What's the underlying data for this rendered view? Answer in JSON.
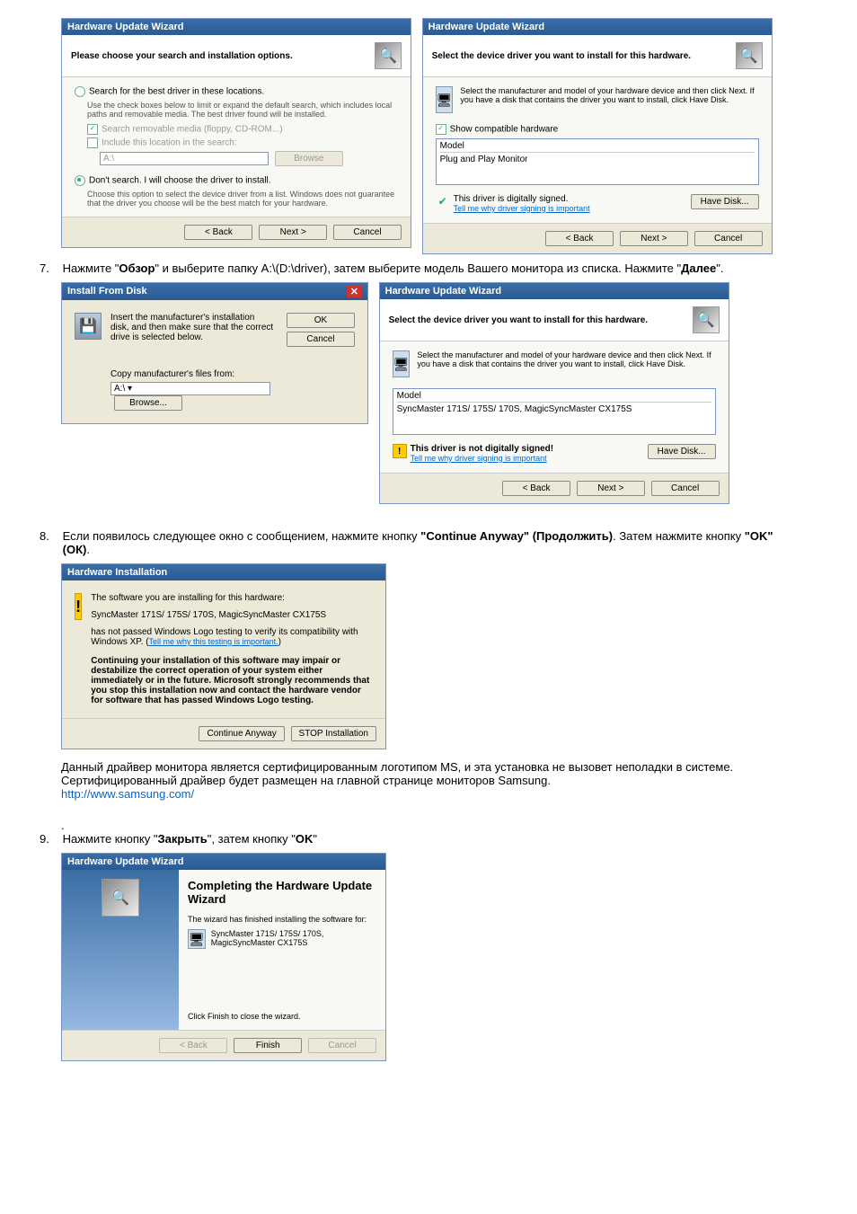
{
  "step7": {
    "num": "7.",
    "text_a": "Нажмите \"",
    "bold_a": "Обзор",
    "text_b": "\" и выберите папку A:\\(D:\\driver), затем выберите модель Вашего монитора из списка. Нажмите \"",
    "bold_b": "Далее",
    "text_c": "\"."
  },
  "step8": {
    "num": "8.",
    "text_a": "Если появилось следующее окно с сообщением, нажмите кнопку ",
    "bold_a": "\"Continue Anyway\" (Продолжить)",
    "text_b": ". Затем нажмите кнопку ",
    "bold_b": "\"OK\" (ОК)",
    "text_c": ".",
    "after_a": "Данный драйвер монитора является сертифицированным логотипом MS, и эта установка не вызовет неполадки в системе. Сертифицированный драйвер будет размещен на главной странице мониторов Samsung.",
    "link": "http://www.samsung.com/"
  },
  "step9": {
    "num": "9.",
    "text_dot": ".",
    "text_a": "Нажмите кнопку \"",
    "bold_a": "Закрыть",
    "text_b": "\", затем кнопку \"",
    "bold_b": "OK",
    "text_c": "\""
  },
  "wiz1": {
    "title": "Hardware Update Wizard",
    "header": "Please choose your search and installation options.",
    "r1": "Search for the best driver in these locations.",
    "r1sub": "Use the check boxes below to limit or expand the default search, which includes local paths and removable media. The best driver found will be installed.",
    "c1": "Search removable media (floppy, CD-ROM...)",
    "c2": "Include this location in the search:",
    "path": "A:\\",
    "browse": "Browse",
    "r2": "Don't search. I will choose the driver to install.",
    "r2sub": "Choose this option to select the device driver from a list. Windows does not guarantee that the driver you choose will be the best match for your hardware.",
    "back": "< Back",
    "next": "Next >",
    "cancel": "Cancel"
  },
  "wiz2": {
    "title": "Hardware Update Wizard",
    "header": "Select the device driver you want to install for this hardware.",
    "desc": "Select the manufacturer and model of your hardware device and then click Next. If you have a disk that contains the driver you want to install, click Have Disk.",
    "showcompat": "Show compatible hardware",
    "modelhdr": "Model",
    "model": "Plug and Play Monitor",
    "signed": "This driver is digitally signed.",
    "tell": "Tell me why driver signing is important",
    "havedisk": "Have Disk...",
    "back": "< Back",
    "next": "Next >",
    "cancel": "Cancel"
  },
  "ifd": {
    "title": "Install From Disk",
    "msg": "Insert the manufacturer's installation disk, and then make sure that the correct drive is selected below.",
    "ok": "OK",
    "cancel": "Cancel",
    "copy": "Copy manufacturer's files from:",
    "path": "A:\\",
    "browse": "Browse..."
  },
  "wiz3": {
    "title": "Hardware Update Wizard",
    "header": "Select the device driver you want to install for this hardware.",
    "desc": "Select the manufacturer and model of your hardware device and then click Next. If you have a disk that contains the driver you want to install, click Have Disk.",
    "modelhdr": "Model",
    "model": "SyncMaster 171S/ 175S/ 170S, MagicSyncMaster CX175S",
    "notsigned": "This driver is not digitally signed!",
    "tell": "Tell me why driver signing is important",
    "havedisk": "Have Disk...",
    "back": "< Back",
    "next": "Next >",
    "cancel": "Cancel"
  },
  "hwinst": {
    "title": "Hardware Installation",
    "l1": "The software you are installing for this hardware:",
    "l2": "SyncMaster 171S/ 175S/ 170S, MagicSyncMaster CX175S",
    "l3a": "has not passed Windows Logo testing to verify its compatibility with Windows XP. (",
    "l3link": "Tell me why this testing is important.",
    "l3b": ")",
    "warn": "Continuing your installation of this software may impair or destabilize the correct operation of your system either immediately or in the future. Microsoft strongly recommends that you stop this installation now and contact the hardware vendor for software that has passed Windows Logo testing.",
    "cont": "Continue Anyway",
    "stop": "STOP Installation"
  },
  "wiz4": {
    "title": "Hardware Update Wizard",
    "complete": "Completing the Hardware Update Wizard",
    "finished": "The wizard has finished installing the software for:",
    "model": "SyncMaster 171S/ 175S/ 170S, MagicSyncMaster CX175S",
    "clickfinish": "Click Finish to close the wizard.",
    "back": "< Back",
    "finish": "Finish",
    "cancel": "Cancel"
  }
}
